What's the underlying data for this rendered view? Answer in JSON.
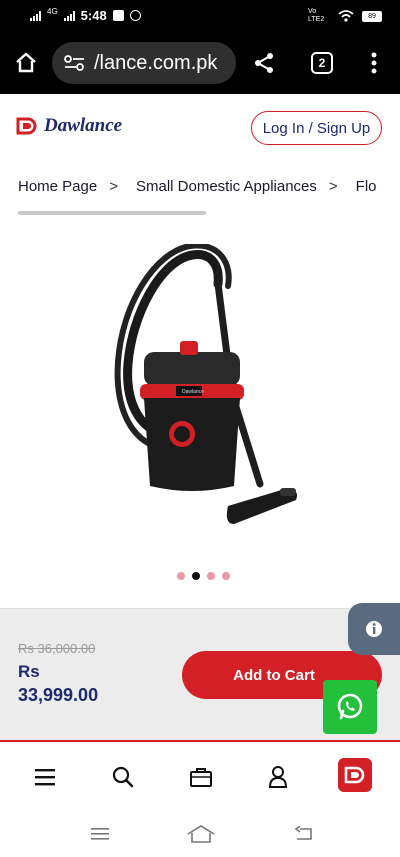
{
  "status_bar": {
    "network": "4G",
    "time": "5:48",
    "volte": "Vo LTE2",
    "battery": "89"
  },
  "browser": {
    "url": "/lance.com.pk",
    "tab_count": "2"
  },
  "header": {
    "logo_text": "Dawlance",
    "login_label": "Log In / Sign Up"
  },
  "breadcrumbs": [
    {
      "label": "Home Page"
    },
    {
      "label": "Small Domestic Appliances"
    },
    {
      "label": "Flo"
    }
  ],
  "breadcrumb_separator": ">",
  "product": {
    "image_label": "Dawlance wet & dry vacuum cleaner",
    "brand_on_image": "Dawlance",
    "carousel_dots": 4,
    "active_dot": 1
  },
  "pricing": {
    "old_price": "Rs 36,000.00",
    "currency": "Rs",
    "price": "33,999.00",
    "add_to_cart_label": "Add to Cart"
  },
  "bottom_nav": {
    "items": [
      "menu-icon",
      "search-icon",
      "cart-icon",
      "account-icon",
      "dawlance-app-icon"
    ]
  },
  "colors": {
    "brand_red": "#d32027",
    "brand_navy": "#1d2a6b",
    "whatsapp_green": "#25c03b",
    "help_gray": "#5b6b7f"
  }
}
